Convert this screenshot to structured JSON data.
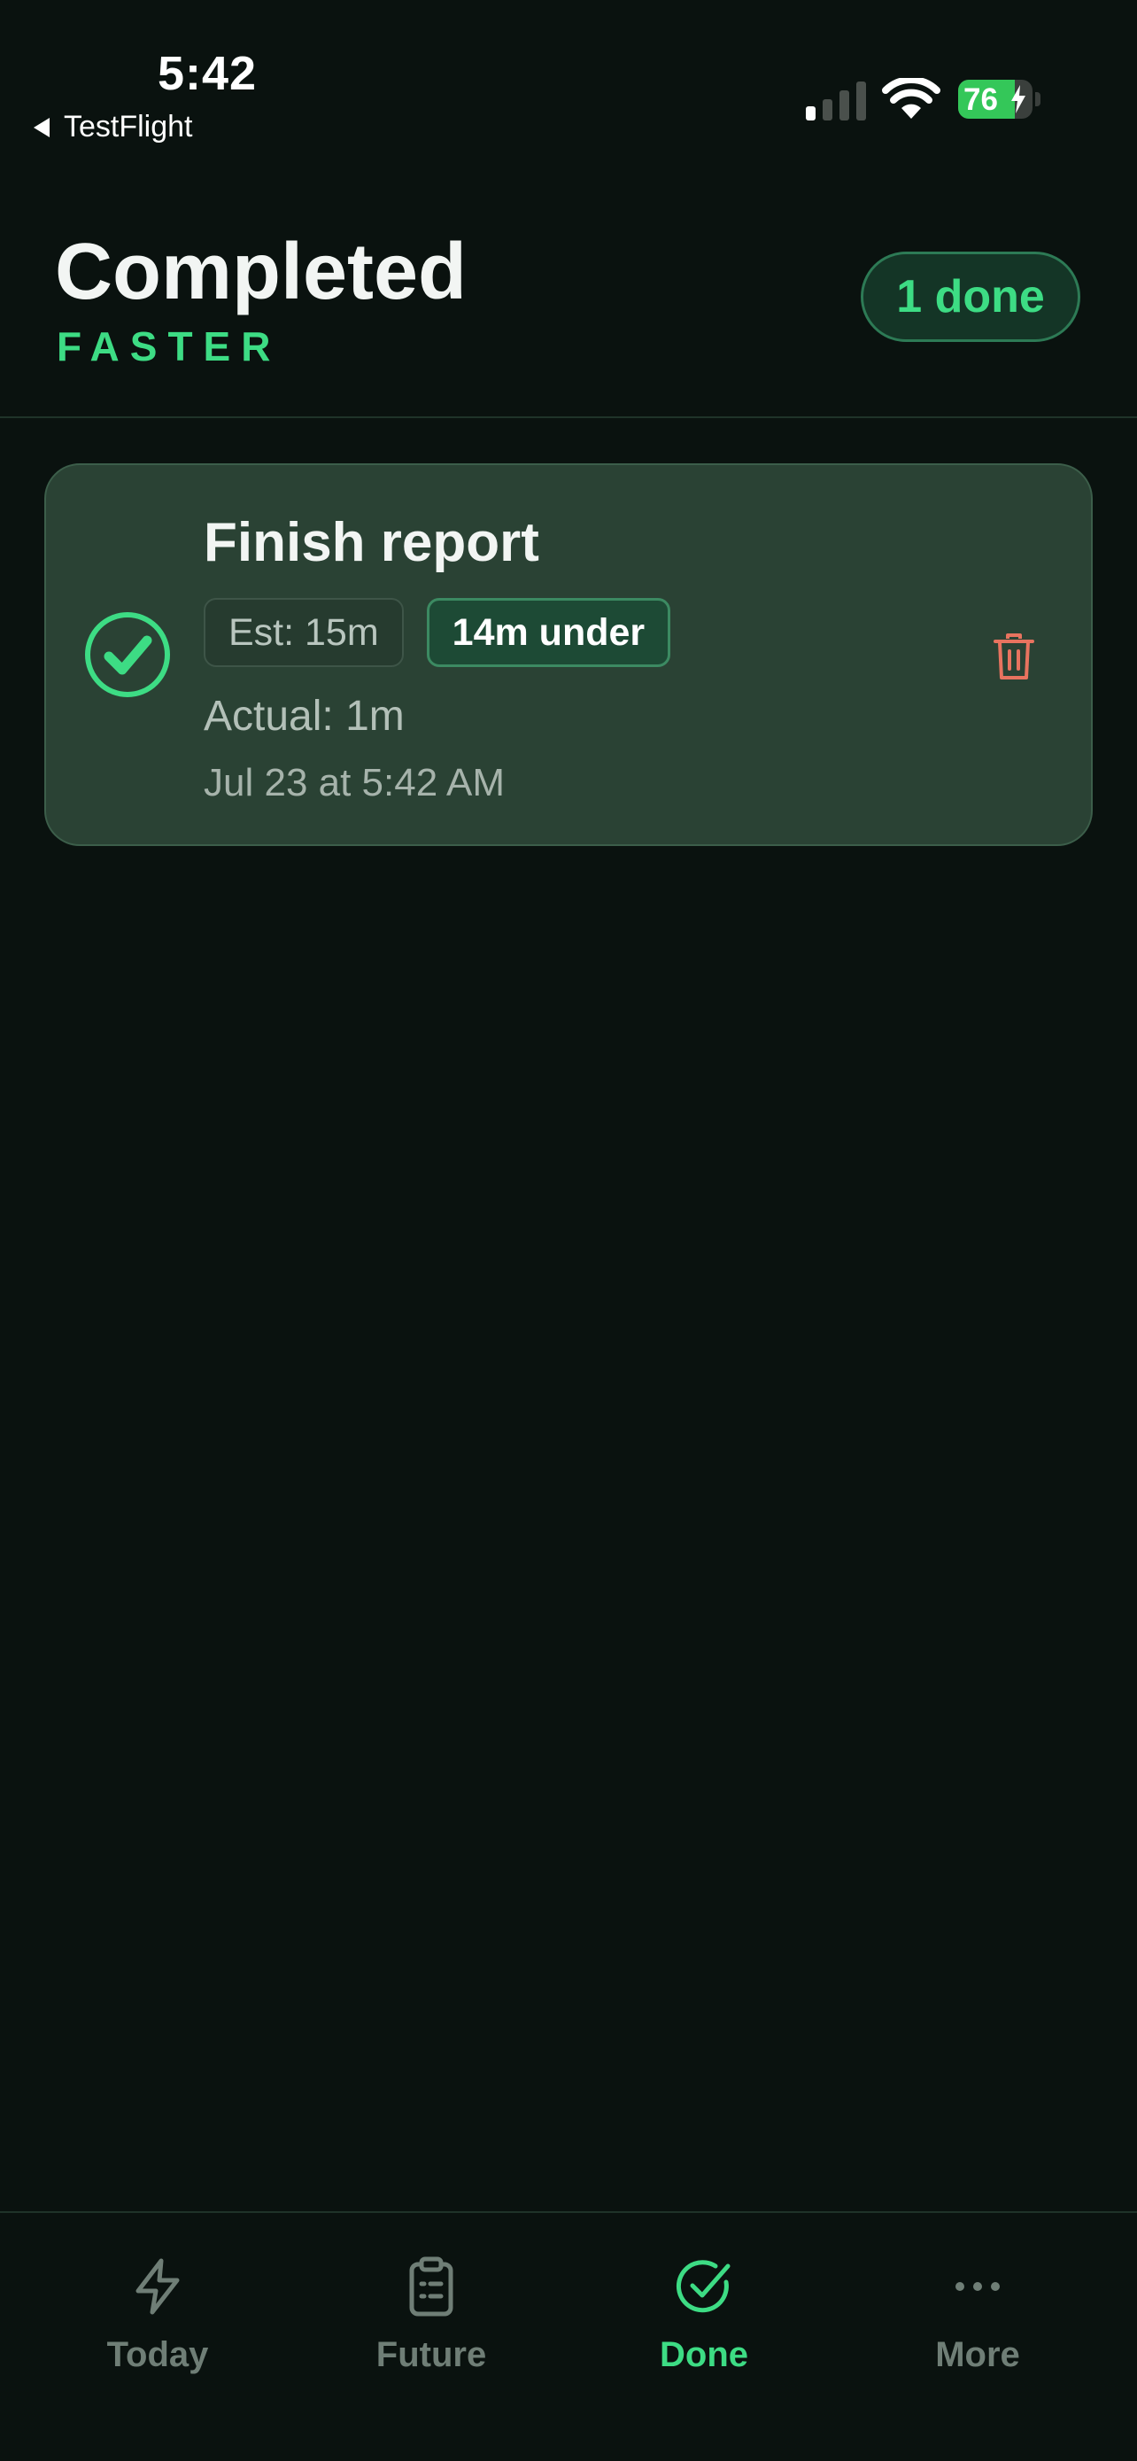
{
  "status_bar": {
    "time": "5:42",
    "back_label": "TestFlight",
    "battery_percent": 76,
    "battery_text": "76"
  },
  "header": {
    "title": "Completed",
    "subtitle": "FASTER",
    "badge": "1 done"
  },
  "tasks": [
    {
      "title": "Finish report",
      "estimate": "Est: 15m",
      "delta": "14m under",
      "actual": "Actual: 1m",
      "completed_at": "Jul 23 at 5:42 AM",
      "completed": true
    }
  ],
  "tabs": [
    {
      "label": "Today",
      "icon": "lightning-icon",
      "active": false
    },
    {
      "label": "Future",
      "icon": "clipboard-icon",
      "active": false
    },
    {
      "label": "Done",
      "icon": "check-circle-icon",
      "active": true
    },
    {
      "label": "More",
      "icon": "ellipsis-icon",
      "active": false
    }
  ],
  "colors": {
    "background": "#0a120f",
    "accent": "#3ddc84",
    "card": "#2a4234",
    "danger": "#e8735f",
    "inactive": "#6f7e76"
  }
}
